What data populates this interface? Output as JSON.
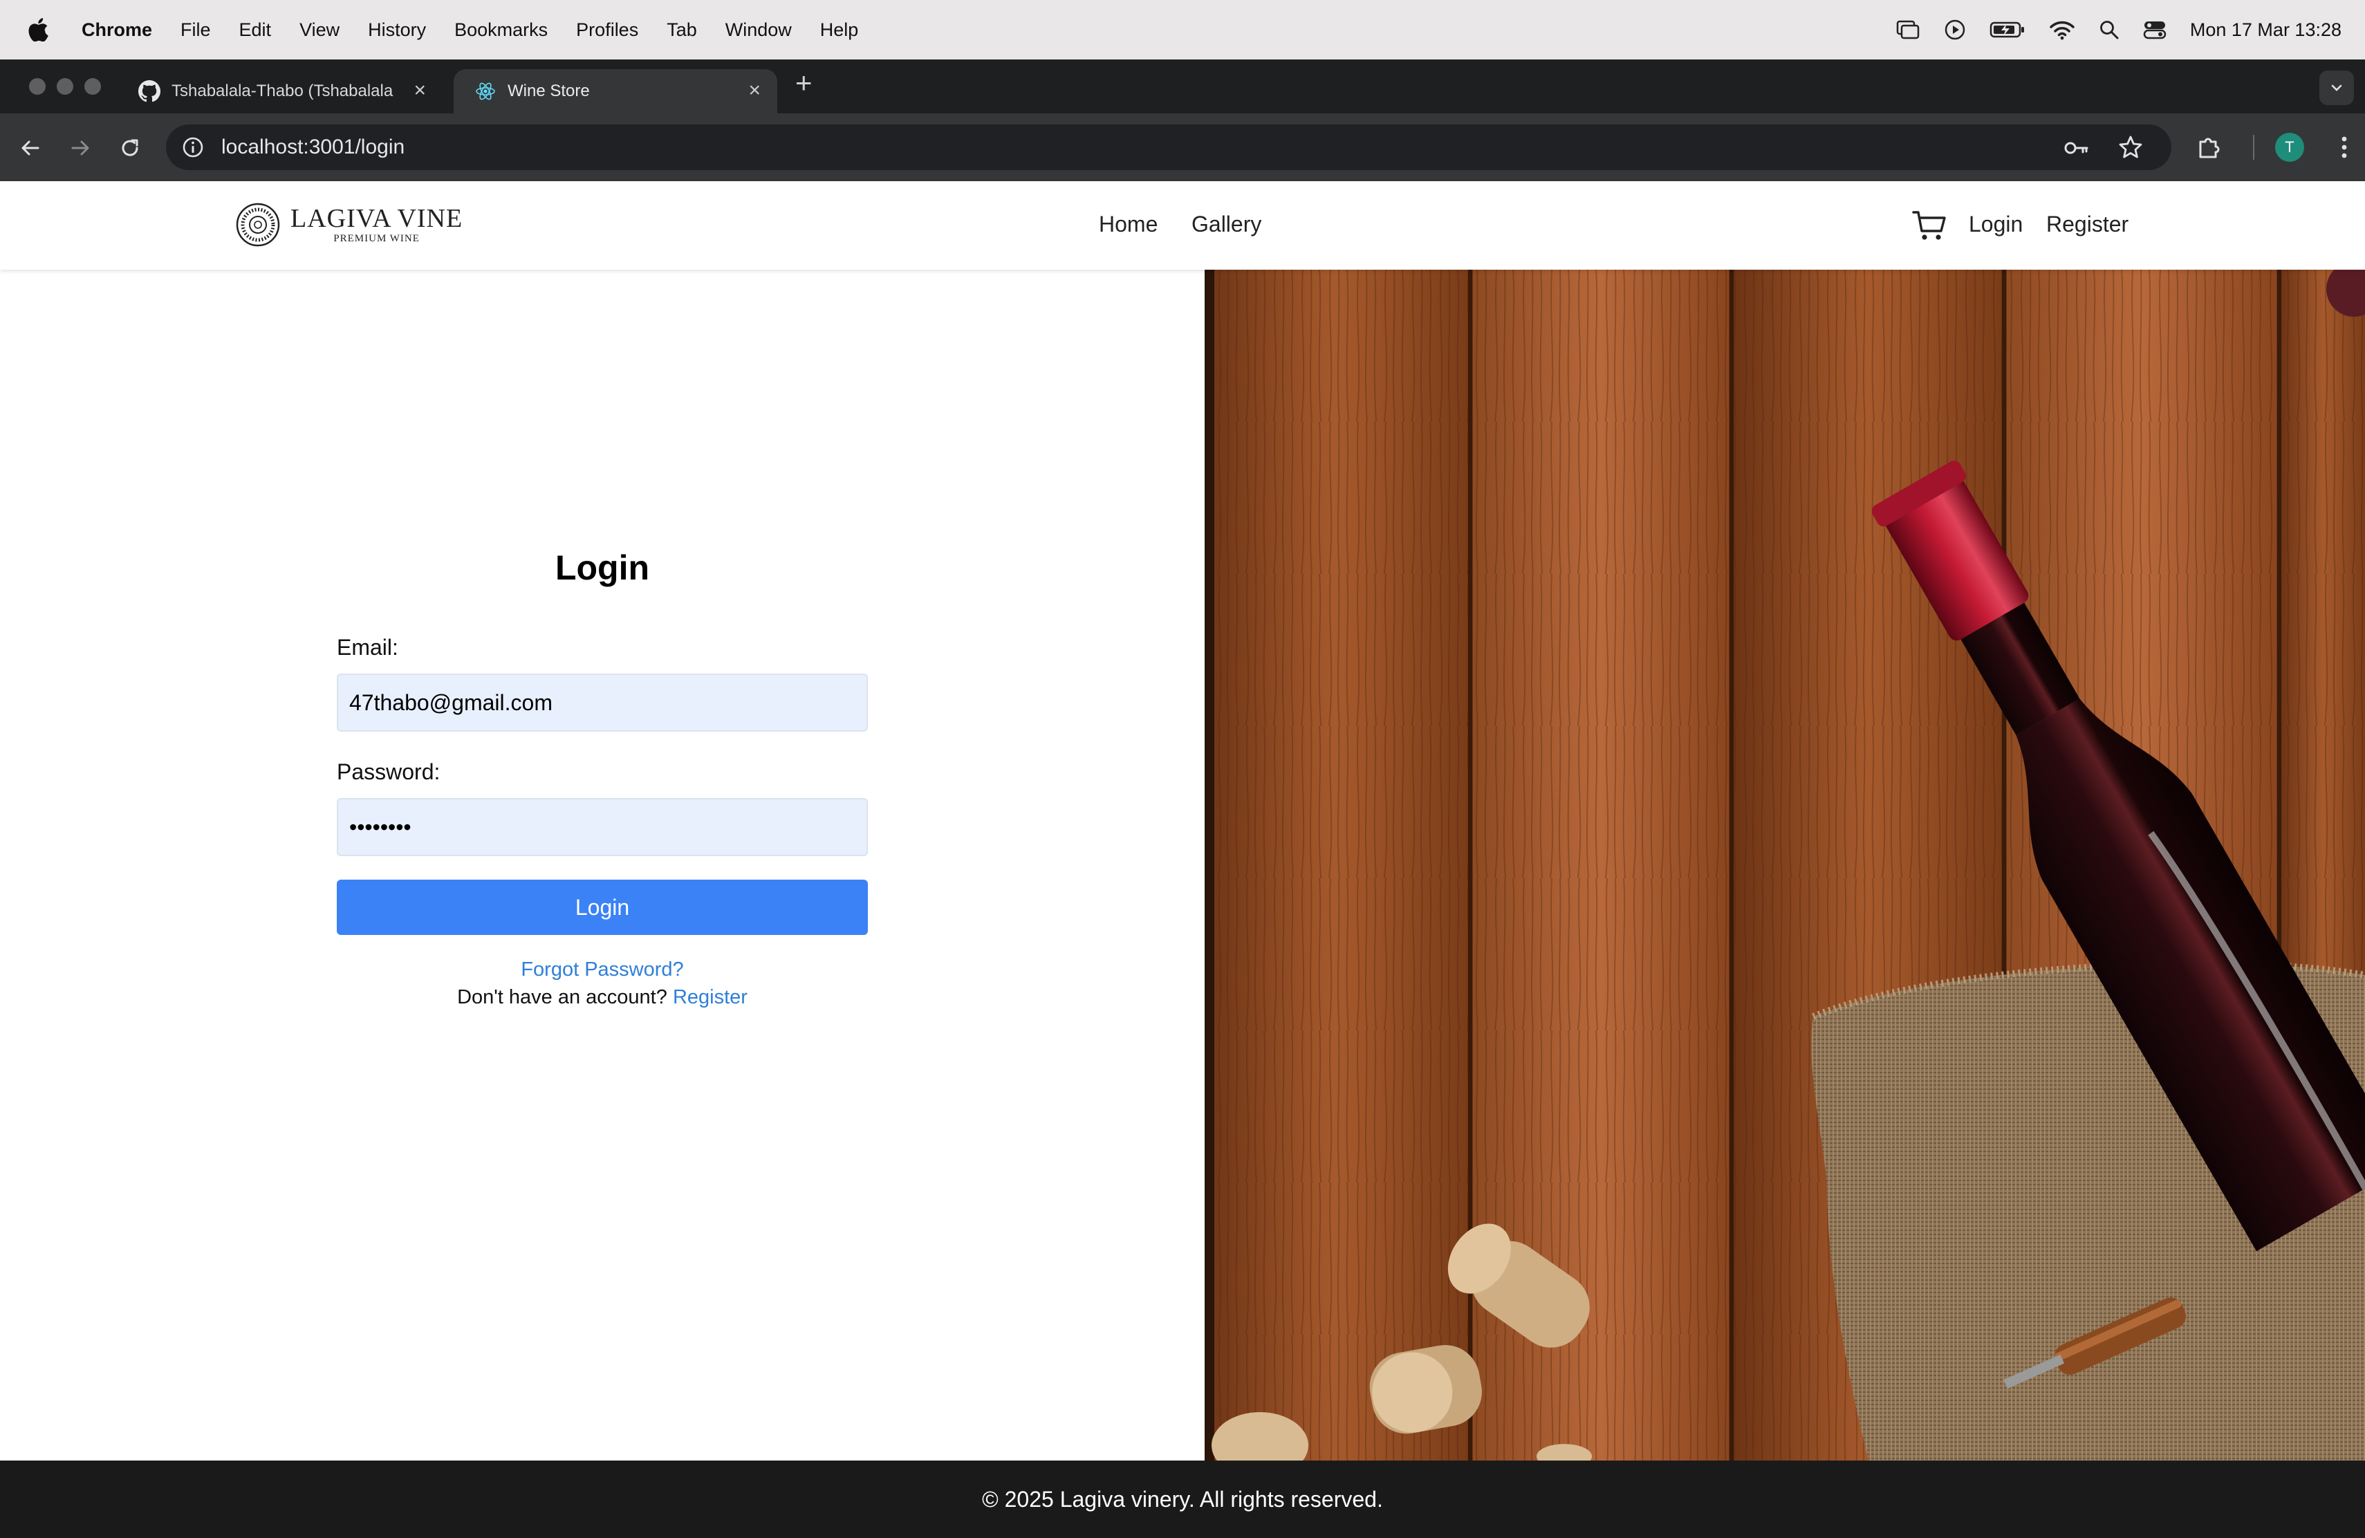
{
  "menubar": {
    "app_name": "Chrome",
    "items": [
      "File",
      "Edit",
      "View",
      "History",
      "Bookmarks",
      "Profiles",
      "Tab",
      "Window",
      "Help"
    ],
    "clock": "Mon 17 Mar  13:28"
  },
  "tabs": [
    {
      "title": "Tshabalala-Thabo (Tshabalala",
      "icon": "github-icon",
      "active": false
    },
    {
      "title": "Wine Store",
      "icon": "react-icon",
      "active": true
    }
  ],
  "toolbar": {
    "url": "localhost:3001/login",
    "profile_initial": "T"
  },
  "site": {
    "logo_name": "LAGIVA VINE",
    "logo_sub": "PREMIUM WINE",
    "nav": {
      "home": "Home",
      "gallery": "Gallery",
      "login": "Login",
      "register": "Register"
    }
  },
  "login_form": {
    "title": "Login",
    "email_label": "Email:",
    "email_value": "47thabo@gmail.com",
    "password_label": "Password:",
    "password_value": "••••••••",
    "submit_label": "Login",
    "forgot_link": "Forgot Password?",
    "no_account_text": "Don't have an account?",
    "register_link": "Register"
  },
  "footer": {
    "text": "© 2025 Lagiva vinery. All rights reserved."
  },
  "colors": {
    "primary_button": "#3b82f6",
    "link": "#2f7fd8",
    "footer_bg": "#1a1a1a",
    "input_autofill_bg": "#e8f0fe"
  }
}
